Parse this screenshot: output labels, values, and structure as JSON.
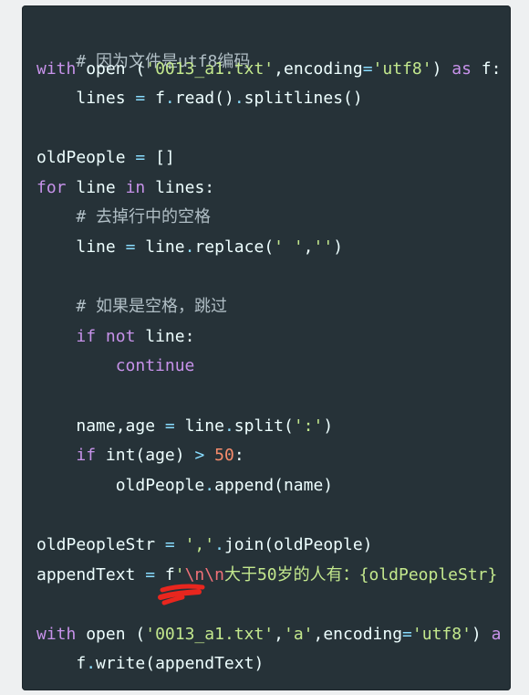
{
  "code": {
    "l1": {
      "text": "# 因为文件是utf8编码"
    },
    "l2": {
      "kw1": "with",
      "sp1": " ",
      "fn": "open",
      "sp2": " ",
      "p1": "(",
      "s1": "'0013_a1.txt'",
      "c1": ",",
      "arg": "encoding",
      "eq": "=",
      "s2": "'utf8'",
      "p2": ")",
      "sp3": " ",
      "kw2": "as",
      "sp4": " ",
      "v": "f:"
    },
    "l3": {
      "indent": "    ",
      "v": "lines",
      "sp": " ",
      "eq": "=",
      "sp2": " ",
      "call": "f",
      "dot1": ".",
      "m1": "read",
      "p1": "()",
      "dot2": ".",
      "m2": "splitlines",
      "p2": "()"
    },
    "l4": {
      "v": "oldPeople",
      "sp": " ",
      "eq": "=",
      "sp2": " ",
      "val": "[]"
    },
    "l5": {
      "kw1": "for",
      "sp1": " ",
      "v1": "line",
      "sp2": " ",
      "kw2": "in",
      "sp3": " ",
      "v2": "lines:"
    },
    "l6": {
      "indent": "    ",
      "text": "# 去掉行中的空格"
    },
    "l7": {
      "indent": "    ",
      "v": "line",
      "sp": " ",
      "eq": "=",
      "sp2": " ",
      "obj": "line",
      "dot": ".",
      "m": "replace",
      "p1": "(",
      "s1": "' '",
      "c": ",",
      "s2": "''",
      "p2": ")"
    },
    "l8": {
      "indent": "    ",
      "text": "# 如果是空格，跳过"
    },
    "l9": {
      "indent": "    ",
      "kw1": "if",
      "sp1": " ",
      "kw2": "not",
      "sp2": " ",
      "v": "line:"
    },
    "l10": {
      "indent": "        ",
      "kw": "continue"
    },
    "l11": {
      "indent": "    ",
      "v": "name,age",
      "sp": " ",
      "eq": "=",
      "sp2": " ",
      "obj": "line",
      "dot": ".",
      "m": "split",
      "p1": "(",
      "s": "':'",
      "p2": ")"
    },
    "l12": {
      "indent": "    ",
      "kw": "if",
      "sp": " ",
      "bi": "int",
      "p": "(age)",
      "sp2": " ",
      "op": ">",
      "sp3": " ",
      "num": "50",
      "colon": ":"
    },
    "l13": {
      "indent": "        ",
      "obj": "oldPeople",
      "dot": ".",
      "m": "append",
      "p": "(name)"
    },
    "l14": {
      "v": "oldPeopleStr",
      "sp": " ",
      "eq": "=",
      "sp2": " ",
      "s": "','",
      "dot": ".",
      "m": "join",
      "p": "(oldPeople)"
    },
    "l15": {
      "v": "appendText",
      "sp": " ",
      "eq": "=",
      "sp2": " ",
      "f": "f",
      "q": "'",
      "esc": "\\n\\n",
      "body": "大于50岁的人有：",
      "interp": "{oldPeopleStr}"
    },
    "l16": {
      "kw1": "with",
      "sp1": " ",
      "fn": "open",
      "sp2": " ",
      "p1": "(",
      "s1": "'0013_a1.txt'",
      "c1": ",",
      "s2": "'a'",
      "c2": ",",
      "arg": "encoding",
      "eq": "=",
      "s3": "'utf8'",
      "p2": ")",
      "sp3": " ",
      "kw2": "a"
    },
    "l17": {
      "indent": "    ",
      "obj": "f",
      "dot": ".",
      "m": "write",
      "p": "(appendText)"
    }
  },
  "colors": {
    "background": "#263238",
    "keyword": "#c792ea",
    "string": "#c3e88d",
    "operator": "#89ddff",
    "number": "#f78c6c",
    "comment": "#b0bec5",
    "escape": "#f07178",
    "text": "#eeffff",
    "annotation": "#e8261e"
  },
  "icons": {
    "scribble": "red-ink-scribble"
  }
}
